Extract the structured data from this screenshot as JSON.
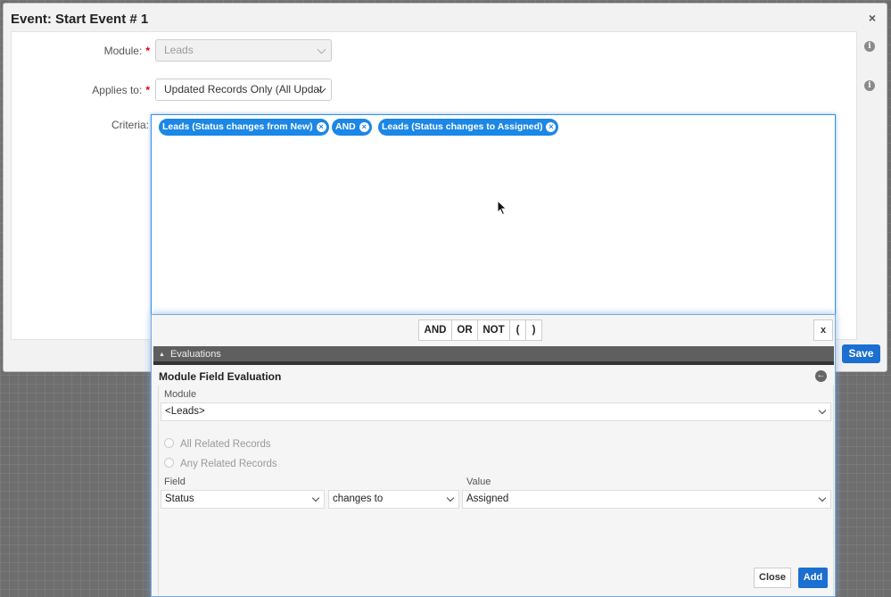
{
  "modal": {
    "title": "Event: Start Event # 1",
    "close_icon": "×"
  },
  "form": {
    "module_label": "Module:",
    "module_value": "Leads",
    "applies_to_label": "Applies to:",
    "applies_to_value": "Updated Records Only (All Updat",
    "criteria_label": "Criteria:",
    "required_mark": "*",
    "info_icon": "i"
  },
  "criteria": {
    "pills": [
      {
        "label": "Leads (Status changes from New)"
      },
      {
        "label": "AND"
      },
      {
        "label": "Leads (Status changes to Assigned)"
      }
    ],
    "remove_icon": "×"
  },
  "buttons": {
    "save": "Save",
    "close": "Close",
    "add": "Add"
  },
  "operators": [
    "AND",
    "OR",
    "NOT",
    "(",
    ")"
  ],
  "operator_close": "x",
  "evaluations": {
    "section_label": "Evaluations",
    "collapse_icon": "▲",
    "panel_title": "Module Field Evaluation",
    "back_icon": "←",
    "module_label": "Module",
    "module_value": "<Leads>",
    "radio_all": "All Related Records",
    "radio_any": "Any Related Records",
    "field_label": "Field",
    "field_value": "Status",
    "operator_value": "changes to",
    "value_label": "Value",
    "value_value": "Assigned"
  },
  "colors": {
    "accent": "#1b87e6",
    "primary_button": "#1b6fd0",
    "required": "#dd0000"
  }
}
